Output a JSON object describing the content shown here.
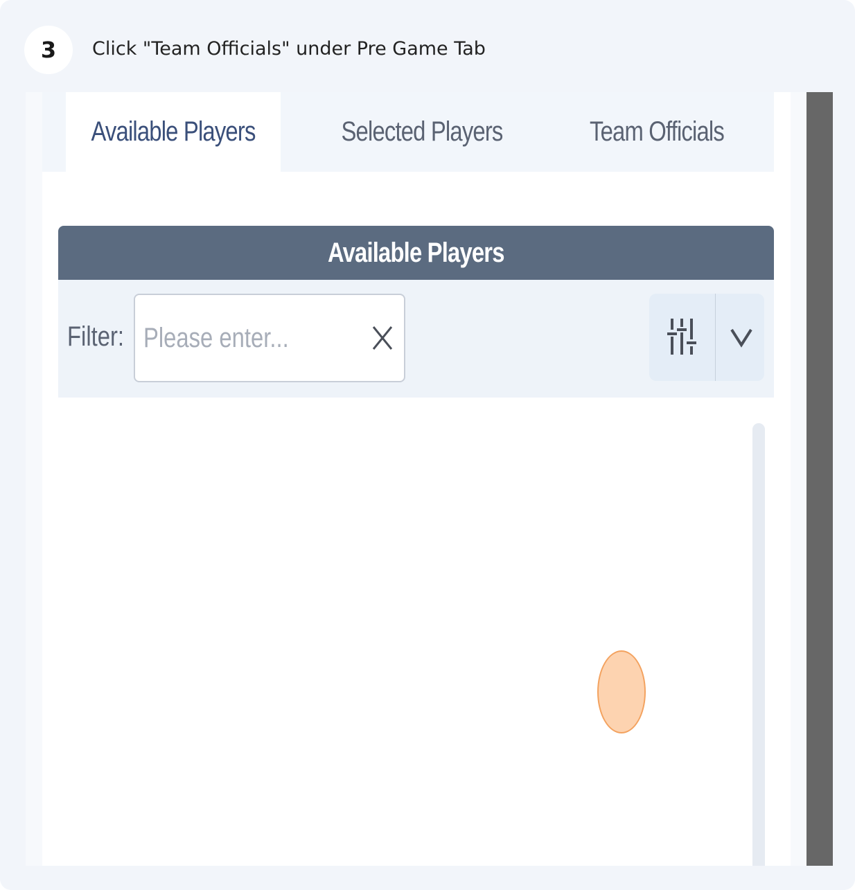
{
  "step": {
    "number": "3",
    "instruction": "Click \"Team Officials\" under Pre Game Tab"
  },
  "tabs": [
    {
      "label": "Available Players",
      "active": true
    },
    {
      "label": "Selected Players",
      "active": false
    },
    {
      "label": "Team Officials",
      "active": false
    }
  ],
  "section": {
    "title": "Available Players"
  },
  "filter": {
    "label": "Filter:",
    "placeholder": "Please enter...",
    "value": ""
  },
  "icons": {
    "clear": "close-icon",
    "settings": "sliders-icon",
    "expand": "chevron-down-icon"
  },
  "colors": {
    "header_bg": "#5b6b80",
    "active_tab_text": "#3a4f7a",
    "click_marker": "#fcc496"
  }
}
